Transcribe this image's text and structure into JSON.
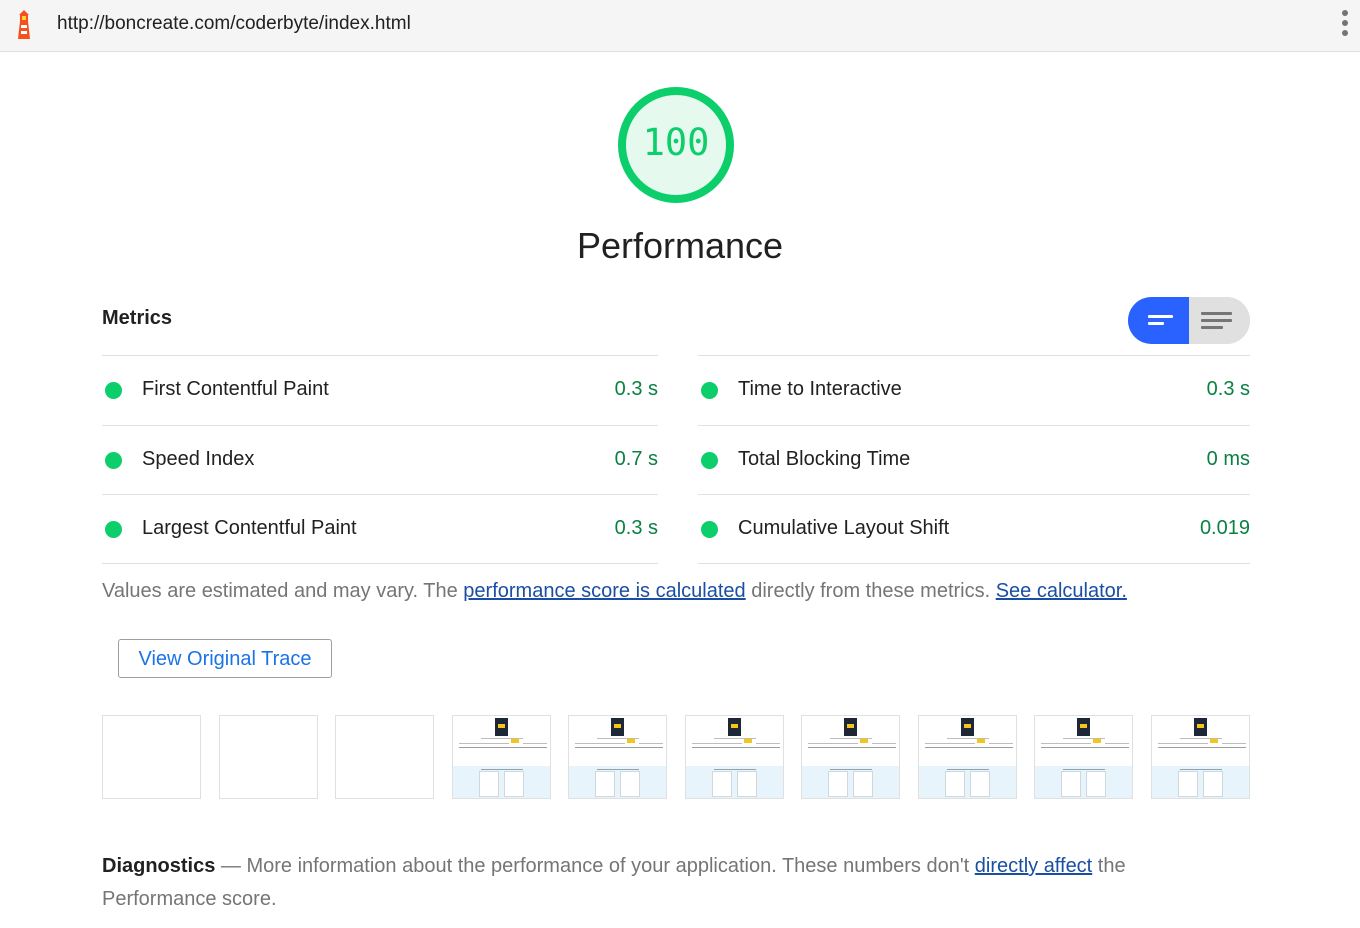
{
  "browser": {
    "url": "http://boncreate.com/coderbyte/index.html",
    "logo_icon": "lighthouse-icon",
    "menu_icon": "kebab-menu-icon"
  },
  "score": {
    "value": "100",
    "fraction": 1.0,
    "title": "Performance",
    "color": "#0cce6b"
  },
  "metrics": {
    "title": "Metrics",
    "toggle": {
      "left_icon": "list-view-icon",
      "right_icon": "text-view-icon",
      "active": "left"
    },
    "left": [
      {
        "label": "First Contentful Paint",
        "value": "0.3 s"
      },
      {
        "label": "Speed Index",
        "value": "0.7 s"
      },
      {
        "label": "Largest Contentful Paint",
        "value": "0.3 s"
      }
    ],
    "right": [
      {
        "label": "Time to Interactive",
        "value": "0.3 s"
      },
      {
        "label": "Total Blocking Time",
        "value": "0 ms"
      },
      {
        "label": "Cumulative Layout Shift",
        "value": "0.019"
      }
    ]
  },
  "note": {
    "text_before": "Values are estimated and may vary. The ",
    "link1": "performance score is calculated",
    "text_middle": " directly from these metrics. ",
    "link2": "See calculator."
  },
  "trace_button": "View Original Trace",
  "filmstrip": {
    "blank_frames": 3,
    "filled_frames": 7
  },
  "diagnostics": {
    "title": "Diagnostics",
    "text_before": " — More information about the performance of your application. These numbers don't ",
    "link": "directly affect",
    "text_after": " the Performance score."
  }
}
